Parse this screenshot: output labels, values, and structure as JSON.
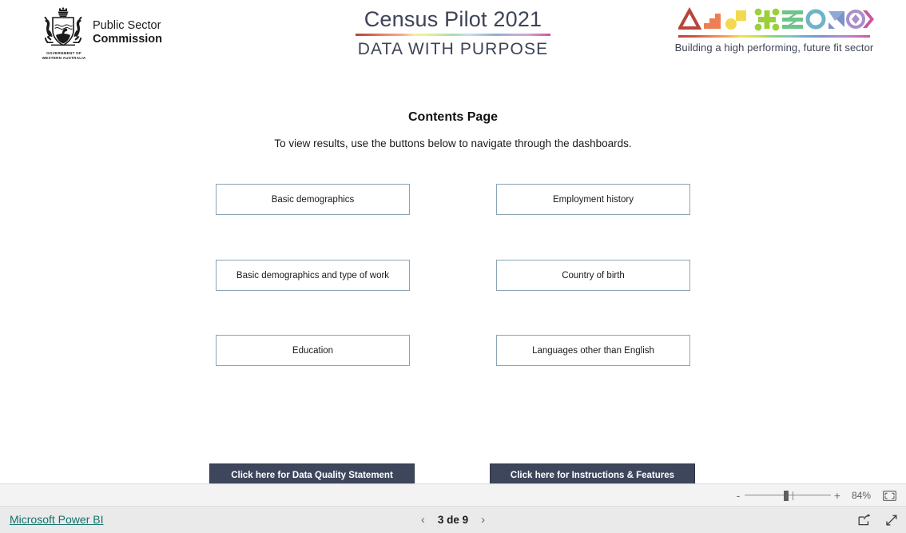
{
  "header": {
    "gov_logo": {
      "icon": "wa-coat-of-arms",
      "caption_line1": "GOVERNMENT OF",
      "caption_line2": "WESTERN AUSTRALIA",
      "org_line1": "Public Sector",
      "org_line2": "Commission"
    },
    "report_title": "Census Pilot 2021",
    "report_subtitle": "DATA WITH PURPOSE",
    "brand": {
      "tagline": "Building a high performing, future fit sector",
      "glyph_colors": [
        "#b8453c",
        "#ee7f55",
        "#f2d94e",
        "#9ccf3c",
        "#6ec48a",
        "#6fb3c9",
        "#7b93cb",
        "#a98fc8",
        "#c9579f"
      ]
    }
  },
  "page": {
    "heading": "Contents Page",
    "subheading": "To view results, use the buttons below to navigate through the dashboards."
  },
  "nav_buttons": [
    {
      "label": "Basic demographics"
    },
    {
      "label": "Employment history"
    },
    {
      "label": "Basic demographics and type of work"
    },
    {
      "label": "Country of birth"
    },
    {
      "label": "Education"
    },
    {
      "label": "Languages other than English"
    }
  ],
  "footer_buttons": [
    {
      "label": "Click here for Data Quality Statement"
    },
    {
      "label": "Click here for Instructions & Features"
    }
  ],
  "zoom_bar": {
    "minus": "-",
    "plus": "+",
    "level": "84%",
    "fit_icon": "fit-to-page-icon"
  },
  "status_bar": {
    "powerbi_link": "Microsoft Power BI",
    "prev_icon": "chevron-left-icon",
    "next_icon": "chevron-right-icon",
    "page_label": "3 de 9",
    "share_icon": "share-icon",
    "fullscreen_icon": "fullscreen-icon"
  },
  "colors": {
    "title_text": "#3e4355",
    "button_border": "#8ba4b6",
    "dark_button_bg": "#3e465c",
    "link_teal": "#10726b",
    "canvas_bg": "#ffffff",
    "statusbar_bg": "#eaeaea"
  }
}
